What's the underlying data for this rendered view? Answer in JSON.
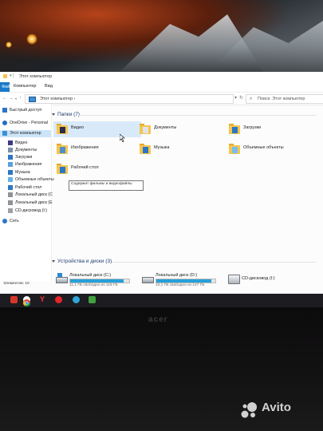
{
  "window": {
    "title": "Этот компьютер",
    "ribbon_tabs": [
      "Файл",
      "Компьютер",
      "Вид"
    ]
  },
  "address_bar": {
    "path": "Этот компьютер",
    "path_chevron": "›",
    "search_placeholder": "Поиск: Этот компьютер"
  },
  "sidebar": {
    "items": [
      {
        "label": "Быстрый доступ",
        "icon": "star-icon"
      },
      {
        "label": "OneDrive - Personal",
        "icon": "cloud-icon"
      },
      {
        "label": "Этот компьютер",
        "icon": "computer-icon",
        "selected": true
      },
      {
        "label": "Видео",
        "icon": "video-folder-icon"
      },
      {
        "label": "Документы",
        "icon": "documents-folder-icon"
      },
      {
        "label": "Загрузки",
        "icon": "downloads-folder-icon"
      },
      {
        "label": "Изображения",
        "icon": "pictures-folder-icon"
      },
      {
        "label": "Музыка",
        "icon": "music-folder-icon"
      },
      {
        "label": "Объемные объекты",
        "icon": "3d-objects-folder-icon"
      },
      {
        "label": "Рабочий стол",
        "icon": "desktop-folder-icon"
      },
      {
        "label": "Локальный диск (C",
        "icon": "drive-icon"
      },
      {
        "label": "Локальный диск (E",
        "icon": "drive-icon"
      },
      {
        "label": "CD-дисковод (I:)",
        "icon": "cd-drive-icon"
      },
      {
        "label": "Сеть",
        "icon": "network-icon"
      }
    ]
  },
  "folders_group": {
    "header": "Папки (7)",
    "items": [
      {
        "label": "Видео",
        "icon": "video-folder-icon"
      },
      {
        "label": "Документы",
        "icon": "documents-folder-icon"
      },
      {
        "label": "Загрузки",
        "icon": "downloads-folder-icon"
      },
      {
        "label": "Изображения",
        "icon": "pictures-folder-icon"
      },
      {
        "label": "Музыка",
        "icon": "music-folder-icon"
      },
      {
        "label": "Объемные объекты",
        "icon": "3d-objects-folder-icon"
      },
      {
        "label": "Рабочий стол",
        "icon": "desktop-folder-icon"
      }
    ],
    "tooltip": "Содержит фильмы и видеофайлы."
  },
  "drives_group": {
    "header": "Устройства и диски (3)",
    "items": [
      {
        "label": "Локальный диск (C:)",
        "free_text": "11,1 ГБ свободно из 119 ГБ",
        "used_fraction": 0.91
      },
      {
        "label": "Локальный диск (D:)",
        "free_text": "10,1 ГБ свободно из 147 ГБ",
        "used_fraction": 0.93
      },
      {
        "label": "CD-дисковод (I:)",
        "free_text": "",
        "used_fraction": null
      }
    ]
  },
  "status_bar": {
    "items_count": "Элементов: 10"
  },
  "taskbar": {
    "icons": [
      "windows-icon",
      "chrome-icon",
      "yandex-icon",
      "opera-icon",
      "telegram-icon",
      "app-icon"
    ]
  },
  "hardware": {
    "brand": "acer"
  },
  "watermark": {
    "text": "Avito"
  },
  "colors": {
    "accent": "#1979ca",
    "selection": "#cce4f7",
    "hover": "#d8eaf9",
    "progress": "#26a0da",
    "folder": "#f5c54e"
  }
}
